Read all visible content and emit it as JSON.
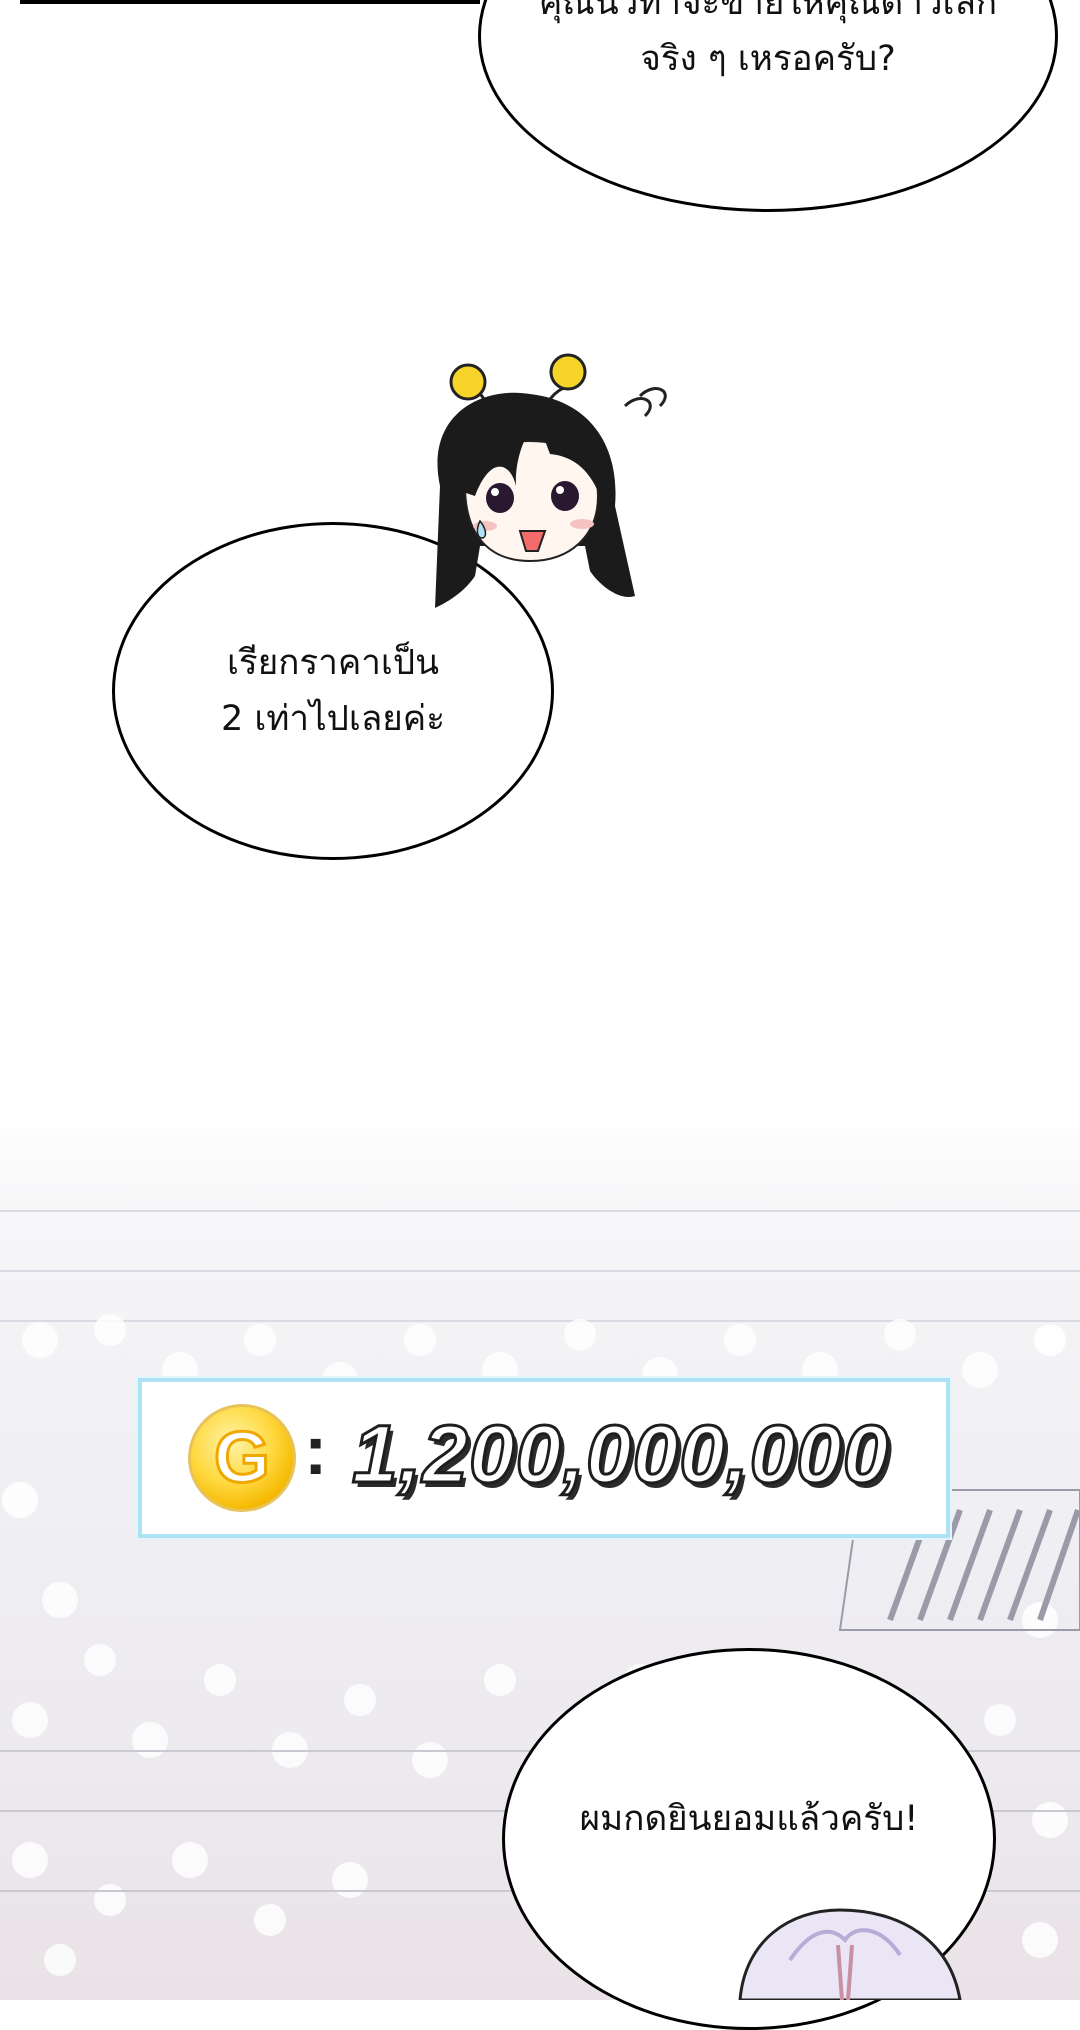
{
  "bubbles": {
    "top": {
      "line1": "คุณนัวทำจะขายให้คุณดำวเลิก",
      "line2": "จริง ๆ เหรอครับ?"
    },
    "middle": {
      "line1": "เรียกราคาเป็น",
      "line2": "2 เท่าไปเลยค่ะ"
    },
    "bottom": {
      "line1": "ผมกดยินยอมแล้วครับ!"
    }
  },
  "price_panel": {
    "currency_symbol": "G",
    "separator": ":",
    "amount": "1,200,000,000",
    "coin_color": "#ffd940",
    "border_color": "#aee3f5"
  },
  "characters": {
    "chibi": "chibi-girl-with-antenna",
    "bottom": "silver-haired-character"
  }
}
